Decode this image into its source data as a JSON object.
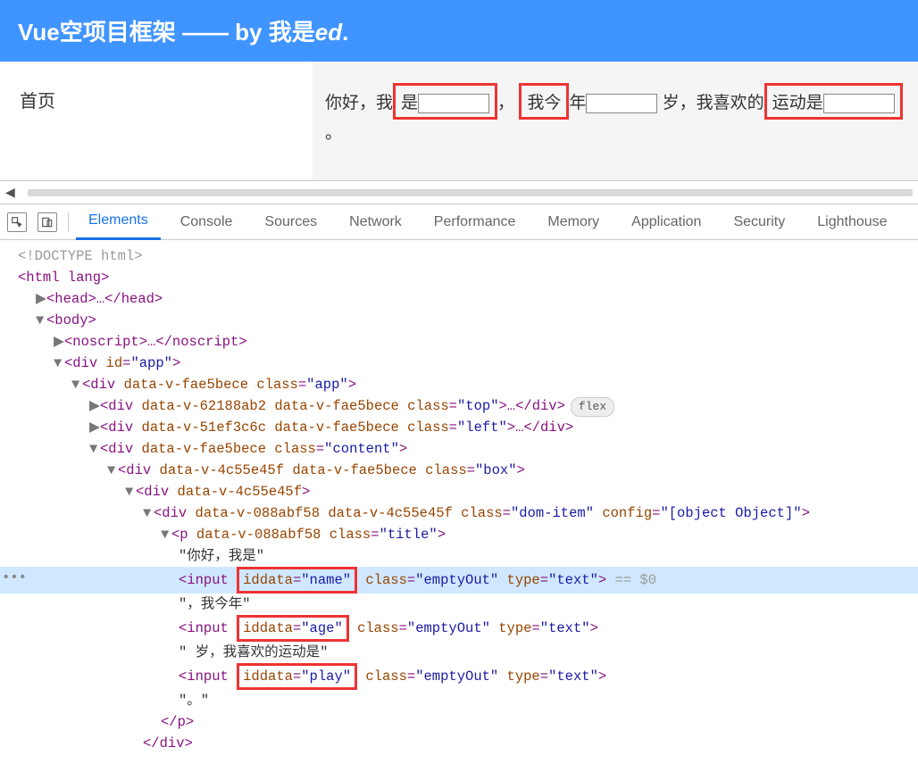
{
  "header": {
    "title_prefix": "Vue空项目框架 —— by 我是",
    "title_em": "ed",
    "title_suffix": "."
  },
  "sidebar": {
    "home": "首页"
  },
  "content": {
    "t1": "你好，我",
    "t1b": "是",
    "t2": "，",
    "t3": "我今",
    "t3b": "年",
    "t4": " 岁，",
    "t5": "我喜欢的",
    "t5b": "运动是",
    "t6": "。"
  },
  "devtools": {
    "tabs": [
      "Elements",
      "Console",
      "Sources",
      "Network",
      "Performance",
      "Memory",
      "Application",
      "Security",
      "Lighthouse"
    ],
    "active_tab": 0
  },
  "dom": {
    "doctype": "<!DOCTYPE html>",
    "html_open": "<html lang>",
    "head": "<head>…</head>",
    "body_open": "<body>",
    "noscript": "<noscript>…</noscript>",
    "div_app": "<div id=\"app\">",
    "div_appclass": "<div data-v-fae5bece class=\"app\">",
    "div_top": "<div data-v-62188ab2 data-v-fae5bece class=\"top\">…</div>",
    "flex_badge": "flex",
    "div_left": "<div data-v-51ef3c6c data-v-fae5bece class=\"left\">…</div>",
    "div_content": "<div data-v-fae5bece class=\"content\">",
    "div_box": "<div data-v-4c55e45f data-v-fae5bece class=\"box\">",
    "div_inner": "<div data-v-4c55e45f>",
    "div_domitem": "<div data-v-088abf58 data-v-4c55e45f class=\"dom-item\" config=\"[object Object]\">",
    "p_title": "<p data-v-088abf58 class=\"title\">",
    "txt1": "\"你好，我是\"",
    "input1_pre": "<input ",
    "input1_attr": "iddata=\"name\"",
    "input1_post": " class=\"emptyOut\" type=\"text\">",
    "eq0": " == $0",
    "txt2": "\"，我今年\"",
    "input2_pre": "<input ",
    "input2_attr": "iddata=\"age\"",
    "input2_post": " class=\"emptyOut\" type=\"text\">",
    "txt3": "\" 岁，我喜欢的运动是\"",
    "input3_pre": "<input ",
    "input3_attr": "iddata=\"play\"",
    "input3_post": " class=\"emptyOut\" type=\"text\">",
    "txt4": "\"。\"",
    "p_close": "</p>",
    "div_close": "</div>"
  }
}
